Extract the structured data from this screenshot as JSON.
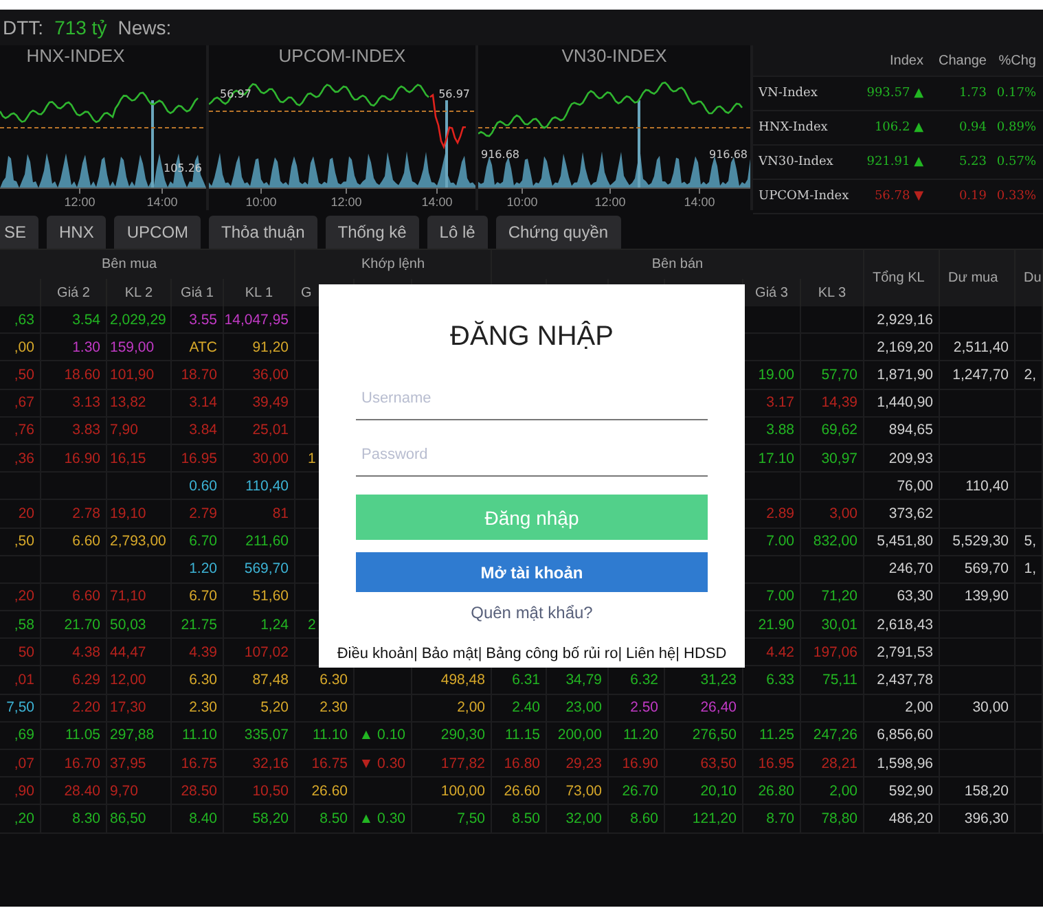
{
  "top_bar": {
    "label": "DTT:",
    "value": "713 tỷ",
    "news_label": "News:"
  },
  "charts": [
    {
      "title": "HNX-INDEX",
      "value_labels": [
        "105.26"
      ],
      "times": [
        "12:00",
        "14:00"
      ]
    },
    {
      "title": "UPCOM-INDEX",
      "value_labels": [
        "56.97",
        "56.97"
      ],
      "times": [
        "10:00",
        "12:00",
        "14:00"
      ]
    },
    {
      "title": "VN30-INDEX",
      "value_labels": [
        "916.68",
        "916.68"
      ],
      "times": [
        "10:00",
        "12:00",
        "14:00"
      ]
    }
  ],
  "index_table": {
    "columns": [
      "Index",
      "Change",
      "%Chg"
    ],
    "rows": [
      {
        "name": "VN-Index",
        "value": "993.57 ▲",
        "change": "1.73",
        "percent": "0.17%",
        "color": "#22b522"
      },
      {
        "name": "HNX-Index",
        "value": "106.2 ▲",
        "change": "0.94",
        "percent": "0.89%",
        "color": "#22b522"
      },
      {
        "name": "VN30-Index",
        "value": "921.91 ▲",
        "change": "5.23",
        "percent": "0.57%",
        "color": "#22b522"
      },
      {
        "name": "UPCOM-Index",
        "value": "56.78 ▼",
        "change": "0.19",
        "percent": "0.33%",
        "color": "#b8221d"
      }
    ]
  },
  "tabs": [
    {
      "label": "SE",
      "selected": false
    },
    {
      "label": "HNX",
      "selected": false
    },
    {
      "label": "UPCOM",
      "selected": false
    },
    {
      "label": "Thỏa thuận",
      "selected": false
    },
    {
      "label": "Thống kê",
      "selected": false
    },
    {
      "label": "Lô lẻ",
      "selected": false
    },
    {
      "label": "Chứng quyền",
      "selected": false
    }
  ],
  "board": {
    "groups": [
      "Bên mua",
      "Khớp lệnh",
      "Bên bán"
    ],
    "side_columns": [
      "Tổng KL",
      "Dư mua",
      "Du"
    ],
    "columns": [
      null,
      "Giá 2",
      "KL 2",
      "Giá 1",
      "KL 1",
      "G",
      null,
      null,
      null,
      null,
      null,
      null,
      "Giá 3",
      "KL 3"
    ],
    "rows": [
      [
        {
          "text": ",63",
          "color": "#22b522"
        },
        {
          "text": "3.54",
          "color": "#22b522"
        },
        {
          "text": "2,029,29",
          "color": "#22b522"
        },
        {
          "text": "3.55",
          "color": "#c23ac6"
        },
        {
          "text": "14,047,95",
          "color": "#c23ac6"
        },
        null,
        null,
        null,
        null,
        null,
        null,
        null,
        null,
        null,
        {
          "text": "2,929,16",
          "color": "#d2d2d2"
        },
        null,
        null
      ],
      [
        {
          "text": ",00",
          "color": "#d8a92a"
        },
        {
          "text": "1.30",
          "color": "#c23ac6"
        },
        {
          "text": "159,00",
          "color": "#c23ac6"
        },
        {
          "text": "ATC",
          "color": "#d8a92a"
        },
        {
          "text": "91,20",
          "color": "#d8a92a"
        },
        null,
        null,
        null,
        null,
        null,
        null,
        null,
        null,
        null,
        {
          "text": "2,169,20",
          "color": "#d2d2d2"
        },
        {
          "text": "2,511,40",
          "color": "#d2d2d2"
        },
        null
      ],
      [
        {
          "text": ",50",
          "color": "#b8221d"
        },
        {
          "text": "18.60",
          "color": "#b8221d"
        },
        {
          "text": "101,90",
          "color": "#b8221d"
        },
        {
          "text": "18.70",
          "color": "#b8221d"
        },
        {
          "text": "36,00",
          "color": "#b8221d"
        },
        null,
        null,
        null,
        null,
        null,
        null,
        null,
        {
          "text": "19.00",
          "color": "#22b522"
        },
        {
          "text": "57,70",
          "color": "#22b522"
        },
        {
          "text": "1,871,90",
          "color": "#d2d2d2"
        },
        {
          "text": "1,247,70",
          "color": "#d2d2d2"
        },
        {
          "text": "2,",
          "color": "#d2d2d2"
        }
      ],
      [
        {
          "text": ",67",
          "color": "#b8221d"
        },
        {
          "text": "3.13",
          "color": "#b8221d"
        },
        {
          "text": "13,82",
          "color": "#b8221d"
        },
        {
          "text": "3.14",
          "color": "#b8221d"
        },
        {
          "text": "39,49",
          "color": "#b8221d"
        },
        null,
        null,
        null,
        null,
        null,
        null,
        null,
        {
          "text": "3.17",
          "color": "#b8221d"
        },
        {
          "text": "14,39",
          "color": "#b8221d"
        },
        {
          "text": "1,440,90",
          "color": "#d2d2d2"
        },
        null,
        null
      ],
      [
        {
          "text": ",76",
          "color": "#b8221d"
        },
        {
          "text": "3.83",
          "color": "#b8221d"
        },
        {
          "text": "7,90",
          "color": "#b8221d"
        },
        {
          "text": "3.84",
          "color": "#b8221d"
        },
        {
          "text": "25,01",
          "color": "#b8221d"
        },
        null,
        null,
        null,
        null,
        null,
        null,
        null,
        {
          "text": "3.88",
          "color": "#22b522"
        },
        {
          "text": "69,62",
          "color": "#22b522"
        },
        {
          "text": "894,65",
          "color": "#d2d2d2"
        },
        null,
        null
      ],
      [
        {
          "text": ",36",
          "color": "#b8221d"
        },
        {
          "text": "16.90",
          "color": "#b8221d"
        },
        {
          "text": "16,15",
          "color": "#b8221d"
        },
        {
          "text": "16.95",
          "color": "#b8221d"
        },
        {
          "text": "30,00",
          "color": "#b8221d"
        },
        {
          "text": "1",
          "color": "#d8a92a"
        },
        null,
        null,
        null,
        null,
        null,
        null,
        {
          "text": "17.10",
          "color": "#22b522"
        },
        {
          "text": "30,97",
          "color": "#22b522"
        },
        {
          "text": "209,93",
          "color": "#d2d2d2"
        },
        null,
        null
      ],
      [
        null,
        null,
        null,
        {
          "text": "0.60",
          "color": "#3db4d6"
        },
        {
          "text": "110,40",
          "color": "#3db4d6"
        },
        null,
        null,
        null,
        null,
        null,
        null,
        null,
        null,
        null,
        {
          "text": "76,00",
          "color": "#d2d2d2"
        },
        {
          "text": "110,40",
          "color": "#d2d2d2"
        },
        null
      ],
      [
        {
          "text": "20",
          "color": "#b8221d"
        },
        {
          "text": "2.78",
          "color": "#b8221d"
        },
        {
          "text": "19,10",
          "color": "#b8221d"
        },
        {
          "text": "2.79",
          "color": "#b8221d"
        },
        {
          "text": "81",
          "color": "#b8221d"
        },
        null,
        null,
        null,
        null,
        null,
        null,
        null,
        {
          "text": "2.89",
          "color": "#b8221d"
        },
        {
          "text": "3,00",
          "color": "#b8221d"
        },
        {
          "text": "373,62",
          "color": "#d2d2d2"
        },
        null,
        null
      ],
      [
        {
          "text": ",50",
          "color": "#d8a92a"
        },
        {
          "text": "6.60",
          "color": "#d8a92a"
        },
        {
          "text": "2,793,00",
          "color": "#d8a92a"
        },
        {
          "text": "6.70",
          "color": "#22b522"
        },
        {
          "text": "211,60",
          "color": "#22b522"
        },
        null,
        null,
        null,
        null,
        null,
        null,
        null,
        {
          "text": "7.00",
          "color": "#22b522"
        },
        {
          "text": "832,00",
          "color": "#22b522"
        },
        {
          "text": "5,451,80",
          "color": "#d2d2d2"
        },
        {
          "text": "5,529,30",
          "color": "#d2d2d2"
        },
        {
          "text": "5,",
          "color": "#d2d2d2"
        }
      ],
      [
        null,
        null,
        null,
        {
          "text": "1.20",
          "color": "#3db4d6"
        },
        {
          "text": "569,70",
          "color": "#3db4d6"
        },
        null,
        null,
        null,
        null,
        null,
        null,
        null,
        null,
        null,
        {
          "text": "246,70",
          "color": "#d2d2d2"
        },
        {
          "text": "569,70",
          "color": "#d2d2d2"
        },
        {
          "text": "1,",
          "color": "#d2d2d2"
        }
      ],
      [
        {
          "text": ",20",
          "color": "#b8221d"
        },
        {
          "text": "6.60",
          "color": "#b8221d"
        },
        {
          "text": "71,10",
          "color": "#b8221d"
        },
        {
          "text": "6.70",
          "color": "#d8a92a"
        },
        {
          "text": "51,60",
          "color": "#d8a92a"
        },
        null,
        null,
        null,
        null,
        null,
        null,
        null,
        {
          "text": "7.00",
          "color": "#22b522"
        },
        {
          "text": "71,20",
          "color": "#22b522"
        },
        {
          "text": "63,30",
          "color": "#d2d2d2"
        },
        {
          "text": "139,90",
          "color": "#d2d2d2"
        },
        null
      ],
      [
        {
          "text": ",58",
          "color": "#22b522"
        },
        {
          "text": "21.70",
          "color": "#22b522"
        },
        {
          "text": "50,03",
          "color": "#22b522"
        },
        {
          "text": "21.75",
          "color": "#22b522"
        },
        {
          "text": "1,24",
          "color": "#22b522"
        },
        {
          "text": "2",
          "color": "#22b522"
        },
        null,
        null,
        null,
        null,
        null,
        null,
        {
          "text": "21.90",
          "color": "#22b522"
        },
        {
          "text": "30,01",
          "color": "#22b522"
        },
        {
          "text": "2,618,43",
          "color": "#d2d2d2"
        },
        null,
        null
      ],
      [
        {
          "text": "50",
          "color": "#b8221d"
        },
        {
          "text": "4.38",
          "color": "#b8221d"
        },
        {
          "text": "44,47",
          "color": "#b8221d"
        },
        {
          "text": "4.39",
          "color": "#b8221d"
        },
        {
          "text": "107,02",
          "color": "#b8221d"
        },
        null,
        null,
        null,
        null,
        null,
        null,
        null,
        {
          "text": "4.42",
          "color": "#b8221d"
        },
        {
          "text": "197,06",
          "color": "#b8221d"
        },
        {
          "text": "2,791,53",
          "color": "#d2d2d2"
        },
        null,
        null
      ],
      [
        {
          "text": ",01",
          "color": "#b8221d"
        },
        {
          "text": "6.29",
          "color": "#b8221d"
        },
        {
          "text": "12,00",
          "color": "#b8221d"
        },
        {
          "text": "6.30",
          "color": "#d8a92a"
        },
        {
          "text": "87,48",
          "color": "#d8a92a"
        },
        {
          "text": "6.30",
          "color": "#d8a92a"
        },
        null,
        {
          "text": "498,48",
          "color": "#d8a92a"
        },
        {
          "text": "6.31",
          "color": "#22b522"
        },
        {
          "text": "34,79",
          "color": "#22b522"
        },
        {
          "text": "6.32",
          "color": "#22b522"
        },
        {
          "text": "31,23",
          "color": "#22b522"
        },
        {
          "text": "6.33",
          "color": "#22b522"
        },
        {
          "text": "75,11",
          "color": "#22b522"
        },
        {
          "text": "2,437,78",
          "color": "#d2d2d2"
        },
        null,
        null
      ],
      [
        {
          "text": "7,50",
          "color": "#3db4d6"
        },
        {
          "text": "2.20",
          "color": "#b8221d"
        },
        {
          "text": "17,30",
          "color": "#b8221d"
        },
        {
          "text": "2.30",
          "color": "#d8a92a"
        },
        {
          "text": "5,20",
          "color": "#d8a92a"
        },
        {
          "text": "2.30",
          "color": "#d8a92a"
        },
        null,
        {
          "text": "2,00",
          "color": "#d8a92a"
        },
        {
          "text": "2.40",
          "color": "#22b522"
        },
        {
          "text": "23,00",
          "color": "#22b522"
        },
        {
          "text": "2.50",
          "color": "#c23ac6"
        },
        {
          "text": "26,40",
          "color": "#c23ac6"
        },
        null,
        null,
        {
          "text": "2,00",
          "color": "#d2d2d2"
        },
        {
          "text": "30,00",
          "color": "#d2d2d2"
        },
        null
      ],
      [
        {
          "text": ",69",
          "color": "#22b522"
        },
        {
          "text": "11.05",
          "color": "#22b522"
        },
        {
          "text": "297,88",
          "color": "#22b522"
        },
        {
          "text": "11.10",
          "color": "#22b522"
        },
        {
          "text": "335,07",
          "color": "#22b522"
        },
        {
          "text": "11.10",
          "color": "#22b522"
        },
        {
          "text": "▲ 0.10",
          "color": "#22b522"
        },
        {
          "text": "290,30",
          "color": "#22b522"
        },
        {
          "text": "11.15",
          "color": "#22b522"
        },
        {
          "text": "200,00",
          "color": "#22b522"
        },
        {
          "text": "11.20",
          "color": "#22b522"
        },
        {
          "text": "276,50",
          "color": "#22b522"
        },
        {
          "text": "11.25",
          "color": "#22b522"
        },
        {
          "text": "247,26",
          "color": "#22b522"
        },
        {
          "text": "6,856,60",
          "color": "#d2d2d2"
        },
        null,
        null
      ],
      [
        {
          "text": ",07",
          "color": "#b8221d"
        },
        {
          "text": "16.70",
          "color": "#b8221d"
        },
        {
          "text": "37,95",
          "color": "#b8221d"
        },
        {
          "text": "16.75",
          "color": "#b8221d"
        },
        {
          "text": "32,16",
          "color": "#b8221d"
        },
        {
          "text": "16.75",
          "color": "#b8221d"
        },
        {
          "text": "▼ 0.30",
          "color": "#b8221d"
        },
        {
          "text": "177,82",
          "color": "#b8221d"
        },
        {
          "text": "16.80",
          "color": "#b8221d"
        },
        {
          "text": "29,23",
          "color": "#b8221d"
        },
        {
          "text": "16.90",
          "color": "#b8221d"
        },
        {
          "text": "63,50",
          "color": "#b8221d"
        },
        {
          "text": "16.95",
          "color": "#b8221d"
        },
        {
          "text": "28,21",
          "color": "#b8221d"
        },
        {
          "text": "1,598,96",
          "color": "#d2d2d2"
        },
        null,
        null
      ],
      [
        {
          "text": ",90",
          "color": "#b8221d"
        },
        {
          "text": "28.40",
          "color": "#b8221d"
        },
        {
          "text": "9,70",
          "color": "#b8221d"
        },
        {
          "text": "28.50",
          "color": "#b8221d"
        },
        {
          "text": "10,50",
          "color": "#b8221d"
        },
        {
          "text": "26.60",
          "color": "#d8a92a"
        },
        null,
        {
          "text": "100,00",
          "color": "#d8a92a"
        },
        {
          "text": "26.60",
          "color": "#d8a92a"
        },
        {
          "text": "73,00",
          "color": "#d8a92a"
        },
        {
          "text": "26.70",
          "color": "#22b522"
        },
        {
          "text": "20,10",
          "color": "#22b522"
        },
        {
          "text": "26.80",
          "color": "#22b522"
        },
        {
          "text": "2,00",
          "color": "#22b522"
        },
        {
          "text": "592,90",
          "color": "#d2d2d2"
        },
        {
          "text": "158,20",
          "color": "#d2d2d2"
        },
        null
      ],
      [
        {
          "text": ",20",
          "color": "#22b522"
        },
        {
          "text": "8.30",
          "color": "#22b522"
        },
        {
          "text": "86,50",
          "color": "#22b522"
        },
        {
          "text": "8.40",
          "color": "#22b522"
        },
        {
          "text": "58,20",
          "color": "#22b522"
        },
        {
          "text": "8.50",
          "color": "#22b522"
        },
        {
          "text": "▲ 0.30",
          "color": "#22b522"
        },
        {
          "text": "7,50",
          "color": "#22b522"
        },
        {
          "text": "8.50",
          "color": "#22b522"
        },
        {
          "text": "32,00",
          "color": "#22b522"
        },
        {
          "text": "8.60",
          "color": "#22b522"
        },
        {
          "text": "121,20",
          "color": "#22b522"
        },
        {
          "text": "8.70",
          "color": "#22b522"
        },
        {
          "text": "78,80",
          "color": "#22b522"
        },
        {
          "text": "486,20",
          "color": "#d2d2d2"
        },
        {
          "text": "396,30",
          "color": "#d2d2d2"
        },
        null
      ]
    ]
  },
  "login": {
    "title": "ĐĂNG NHẬP",
    "username": {
      "placeholder": "Username"
    },
    "password": {
      "placeholder": "Password"
    },
    "submit": "Đăng nhập",
    "open_account": "Mở tài khoản",
    "forgot": "Quên mật khẩu?",
    "separator": "|",
    "footer_links": [
      "Điều khoản",
      "Bảo mật",
      "Bảng công bố rủi ro",
      "Liên hệ",
      "HDSD"
    ]
  }
}
